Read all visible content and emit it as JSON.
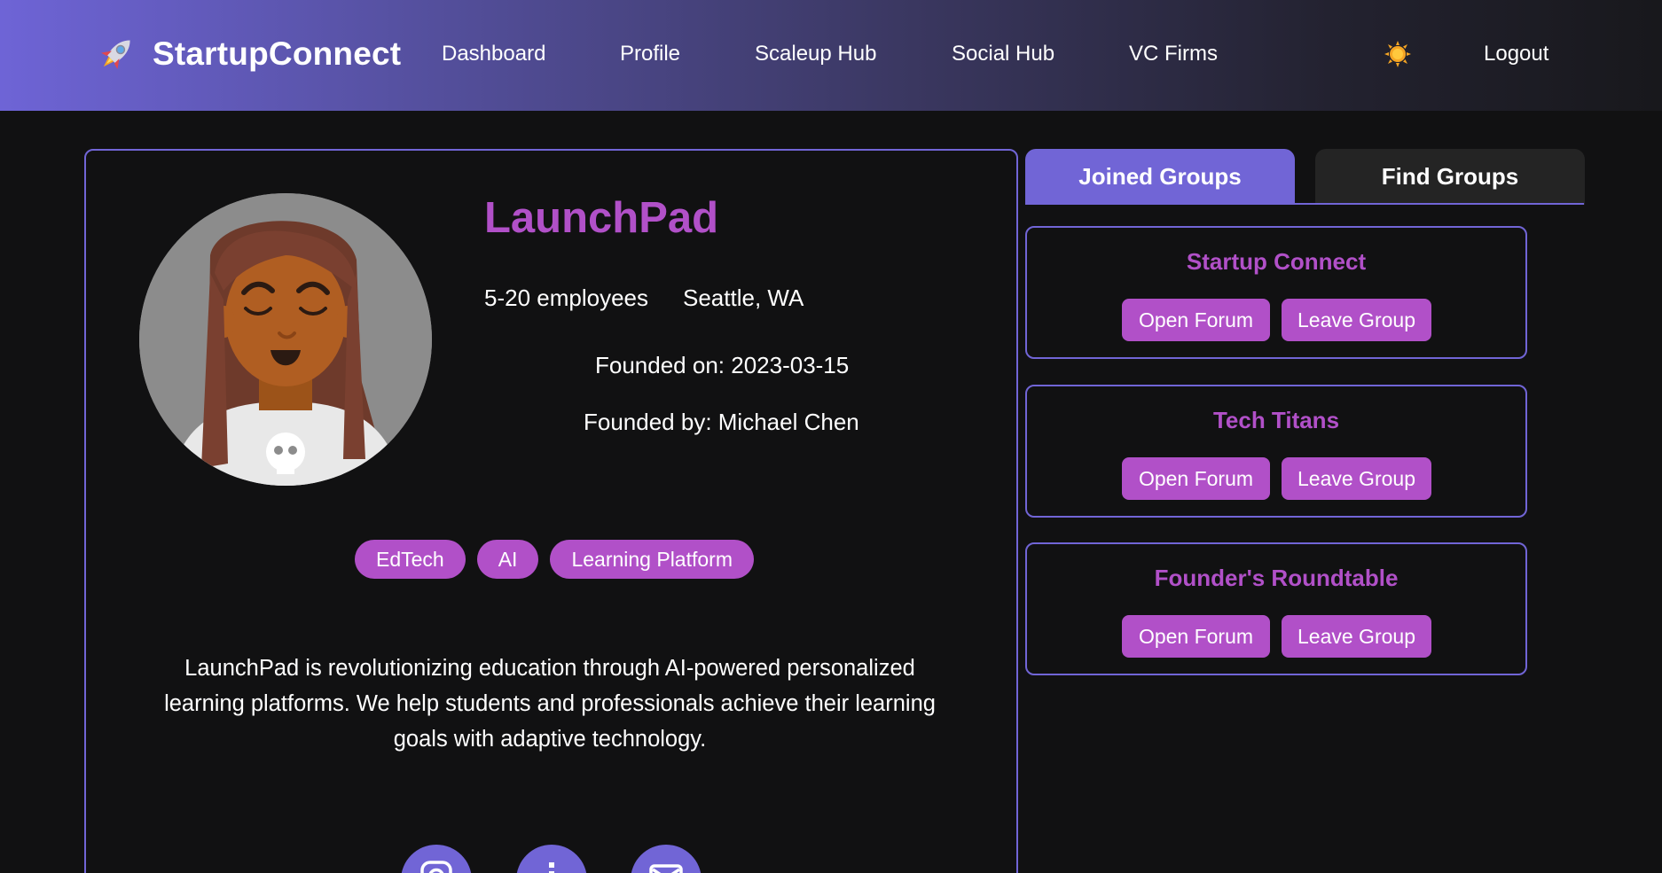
{
  "navbar": {
    "brand_name": "StartupConnect",
    "brand_icon": "rocket-icon",
    "links": [
      "Dashboard",
      "Profile",
      "Scaleup Hub",
      "Social Hub",
      "VC Firms"
    ],
    "theme_icon": "sun-icon",
    "logout_label": "Logout"
  },
  "profile": {
    "company_name": "LaunchPad",
    "employees": "5-20 employees",
    "location": "Seattle, WA",
    "founded_on": "Founded on: 2023-03-15",
    "founded_by": "Founded by: Michael Chen",
    "tags": [
      "EdTech",
      "AI",
      "Learning Platform"
    ],
    "description": "LaunchPad is revolutionizing education through AI-powered personalized learning platforms. We help students and professionals achieve their learning goals with adaptive technology.",
    "social_icons": [
      "instagram-icon",
      "linkedin-icon",
      "email-icon"
    ]
  },
  "groups_panel": {
    "tabs": [
      "Joined Groups",
      "Find Groups"
    ],
    "active_tab": "Joined Groups",
    "groups": [
      {
        "name": "Startup Connect",
        "open_label": "Open Forum",
        "leave_label": "Leave Group"
      },
      {
        "name": "Tech Titans",
        "open_label": "Open Forum",
        "leave_label": "Leave Group"
      },
      {
        "name": "Founder's Roundtable",
        "open_label": "Open Forum",
        "leave_label": "Leave Group"
      }
    ]
  },
  "colors": {
    "accent_purple": "#7165d6",
    "accent_magenta": "#b150c8",
    "background": "#111112"
  }
}
